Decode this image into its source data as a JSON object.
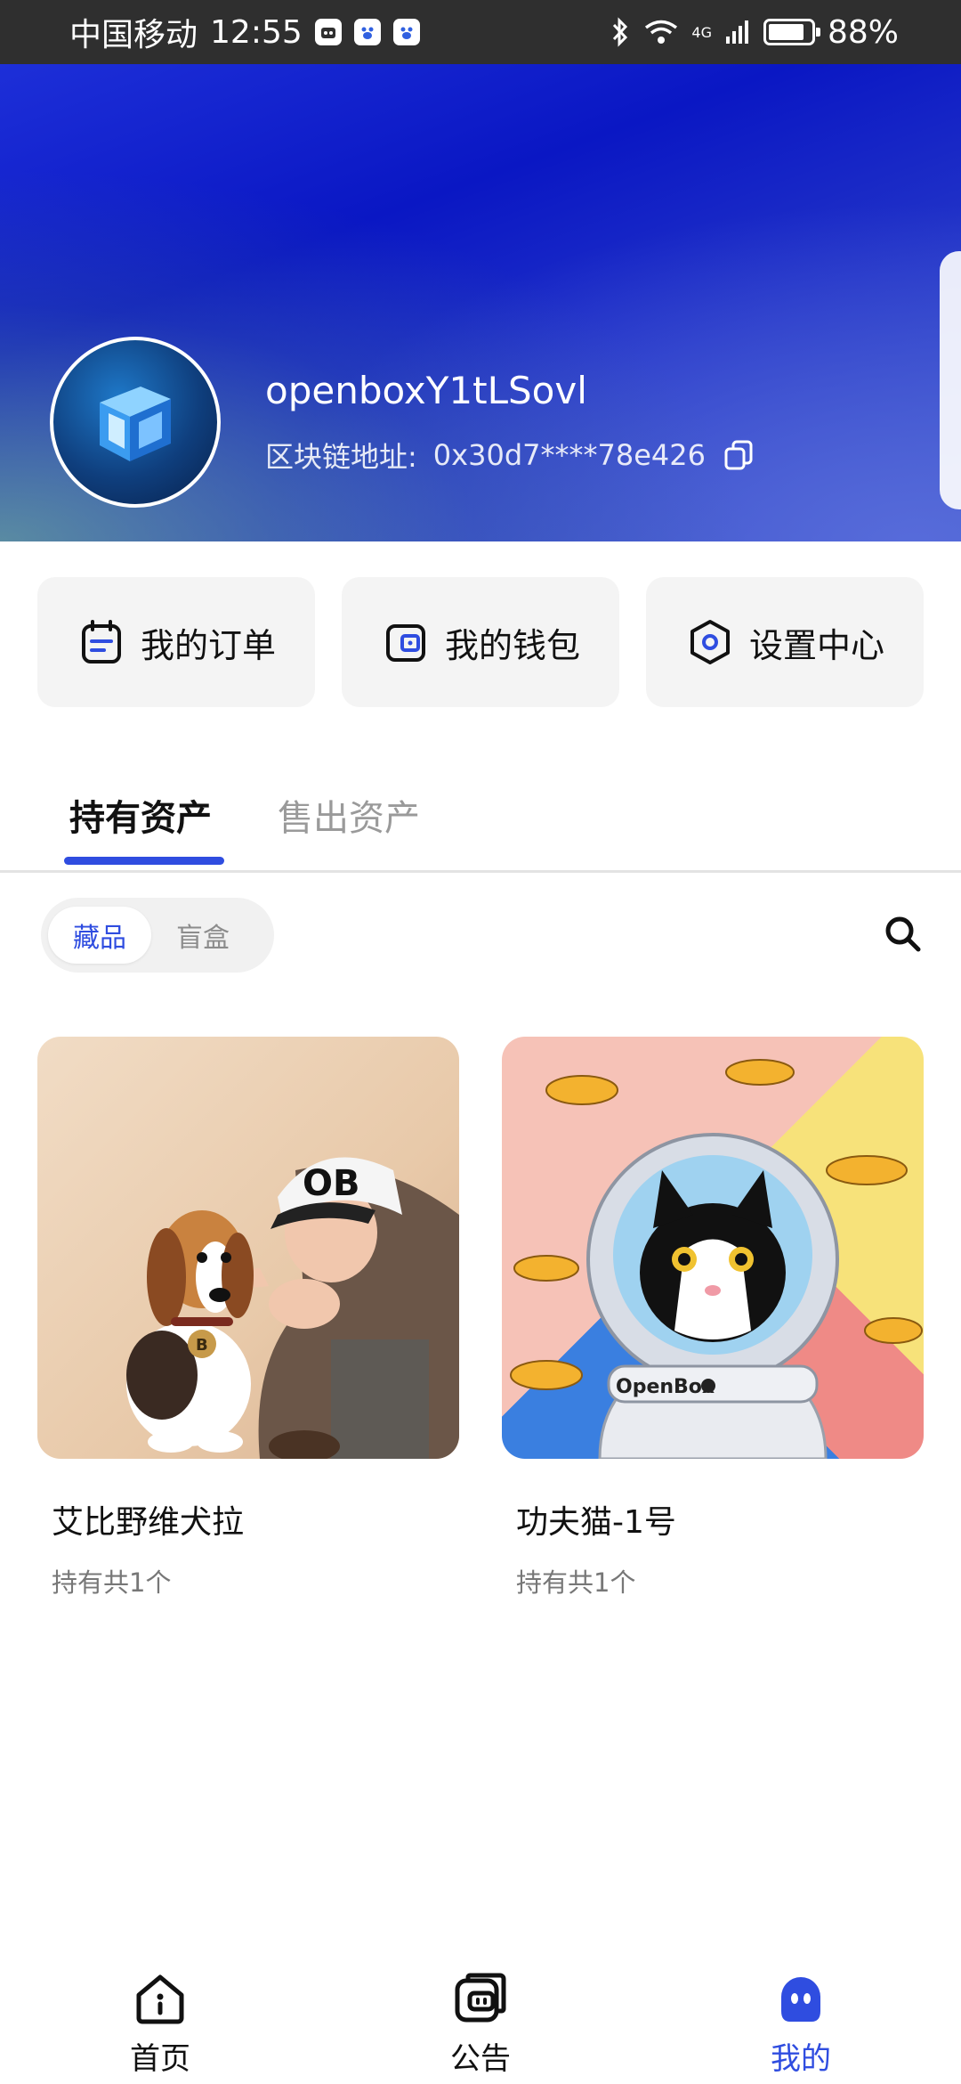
{
  "status_bar": {
    "carrier": "中国移动",
    "time": "12:55",
    "network": "4G",
    "battery": "88%"
  },
  "profile": {
    "username": "openboxY1tLSovl",
    "address_label": "区块链地址:",
    "address_value": "0x30d7****78e426"
  },
  "actions": {
    "orders": "我的订单",
    "wallet": "我的钱包",
    "settings": "设置中心"
  },
  "tabs": {
    "held": "持有资产",
    "sold": "售出资产"
  },
  "segment": {
    "collectibles": "藏品",
    "blind_box": "盲盒"
  },
  "cards": [
    {
      "title": "艾比野维犬拉",
      "subtitle": "持有共1个",
      "cap_text": "OB",
      "tag_text": "B"
    },
    {
      "title": "功夫猫-1号",
      "subtitle": "持有共1个",
      "badge_text": "OpenBox"
    }
  ],
  "bottom_nav": {
    "home": "首页",
    "notice": "公告",
    "mine": "我的"
  },
  "colors": {
    "accent": "#2f4de0",
    "hero_blue": "#0a17c4"
  }
}
